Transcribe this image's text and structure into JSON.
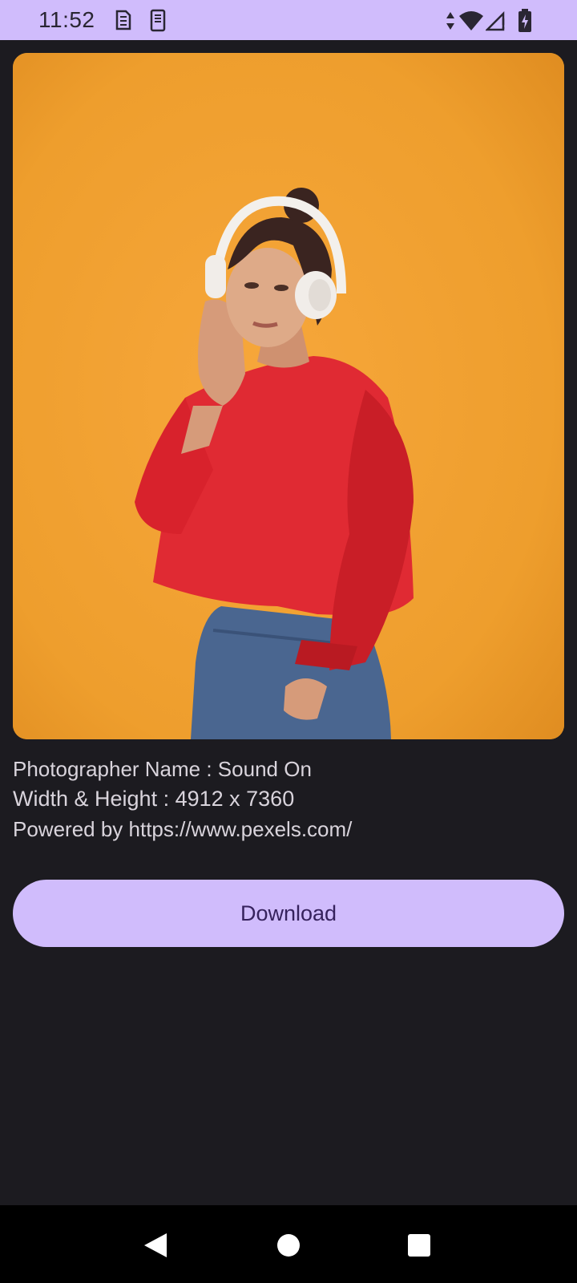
{
  "status_bar": {
    "time": "11:52",
    "icons": [
      "sim-card-icon",
      "phone-storage-icon",
      "data-arrows-icon",
      "wifi-icon",
      "signal-icon",
      "battery-charging-icon"
    ]
  },
  "photo": {
    "description_icon": "photo-of-woman-with-headphones"
  },
  "info": {
    "photographer": "Photographer Name : Sound On",
    "dimensions": "Width & Height : 4912 x 7360",
    "powered_by": "Powered by https://www.pexels.com/"
  },
  "actions": {
    "download_label": "Download"
  },
  "nav": {
    "icons": [
      "back-icon",
      "home-icon",
      "recents-icon"
    ]
  },
  "colors": {
    "accent": "#d0bcfc",
    "background": "#1c1b20",
    "button_text": "#36225d"
  }
}
